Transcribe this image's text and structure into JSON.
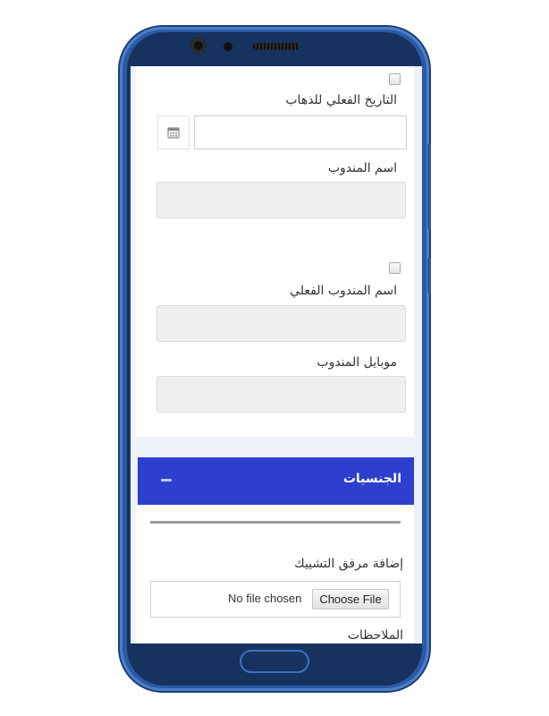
{
  "form": {
    "actual_departure_date_label": "التاريخ الفعلي للذهاب",
    "actual_departure_date_value": "",
    "representative_name_label": "اسم المندوب",
    "representative_name_value": "",
    "actual_representative_name_label": "اسم المندوب الفعلي",
    "actual_representative_name_value": "",
    "representative_mobile_label": "موبايل المندوب",
    "representative_mobile_value": ""
  },
  "section": {
    "title": "الجنسيات",
    "collapse_icon": "minus-icon"
  },
  "attachment": {
    "label": "إضافة مرفق التشييك",
    "button_label": "Choose File",
    "status": "No file chosen"
  },
  "notes": {
    "label": "الملاحظات"
  },
  "colors": {
    "section_header": "#2c3fcf",
    "phone_frame": "#2a5aa6"
  }
}
